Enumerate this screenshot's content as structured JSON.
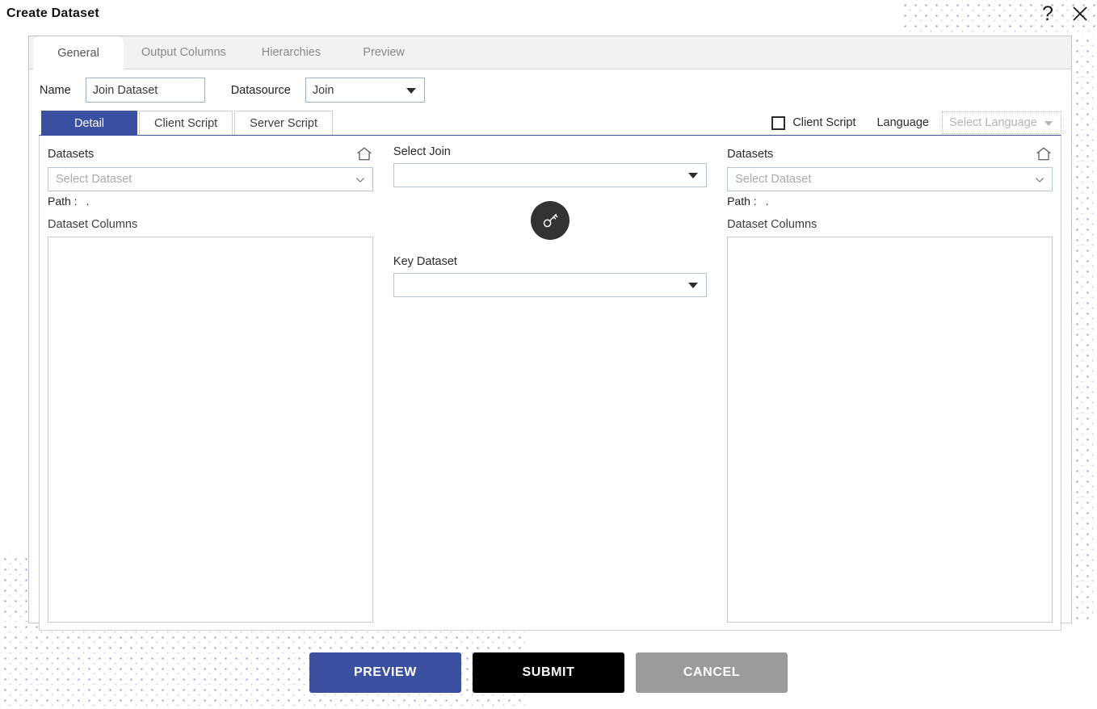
{
  "window": {
    "title": "Create Dataset",
    "help_icon": "question-mark-icon",
    "close_icon": "close-icon"
  },
  "tabs": [
    {
      "label": "General",
      "active": true
    },
    {
      "label": "Output Columns",
      "active": false
    },
    {
      "label": "Hierarchies",
      "active": false
    },
    {
      "label": "Preview",
      "active": false
    }
  ],
  "form": {
    "name_label": "Name",
    "name_value": "Join Dataset",
    "datasource_label": "Datasource",
    "datasource_value": "Join"
  },
  "subtabs": [
    {
      "label": "Detail",
      "active": true
    },
    {
      "label": "Client Script",
      "active": false
    },
    {
      "label": "Server Script",
      "active": false
    }
  ],
  "script_options": {
    "client_script_label": "Client Script",
    "client_script_checked": false,
    "language_label": "Language",
    "language_placeholder": "Select Language"
  },
  "left_panel": {
    "datasets_label": "Datasets",
    "dataset_placeholder": "Select Dataset",
    "path_label": "Path :",
    "path_value": ".",
    "columns_label": "Dataset Columns",
    "columns_items": []
  },
  "middle_panel": {
    "select_join_label": "Select Join",
    "select_join_value": "",
    "key_icon": "key-icon",
    "key_dataset_label": "Key Dataset",
    "key_dataset_value": ""
  },
  "right_panel": {
    "datasets_label": "Datasets",
    "dataset_placeholder": "Select Dataset",
    "path_label": "Path :",
    "path_value": ".",
    "columns_label": "Dataset Columns",
    "columns_items": []
  },
  "footer": {
    "preview_label": "PREVIEW",
    "submit_label": "SUBMIT",
    "cancel_label": "CANCEL"
  },
  "colors": {
    "accent_blue": "#3b50a0",
    "submit_black": "#000000",
    "cancel_gray": "#9b9b9b",
    "dot_pattern": "#9aa4e0"
  }
}
